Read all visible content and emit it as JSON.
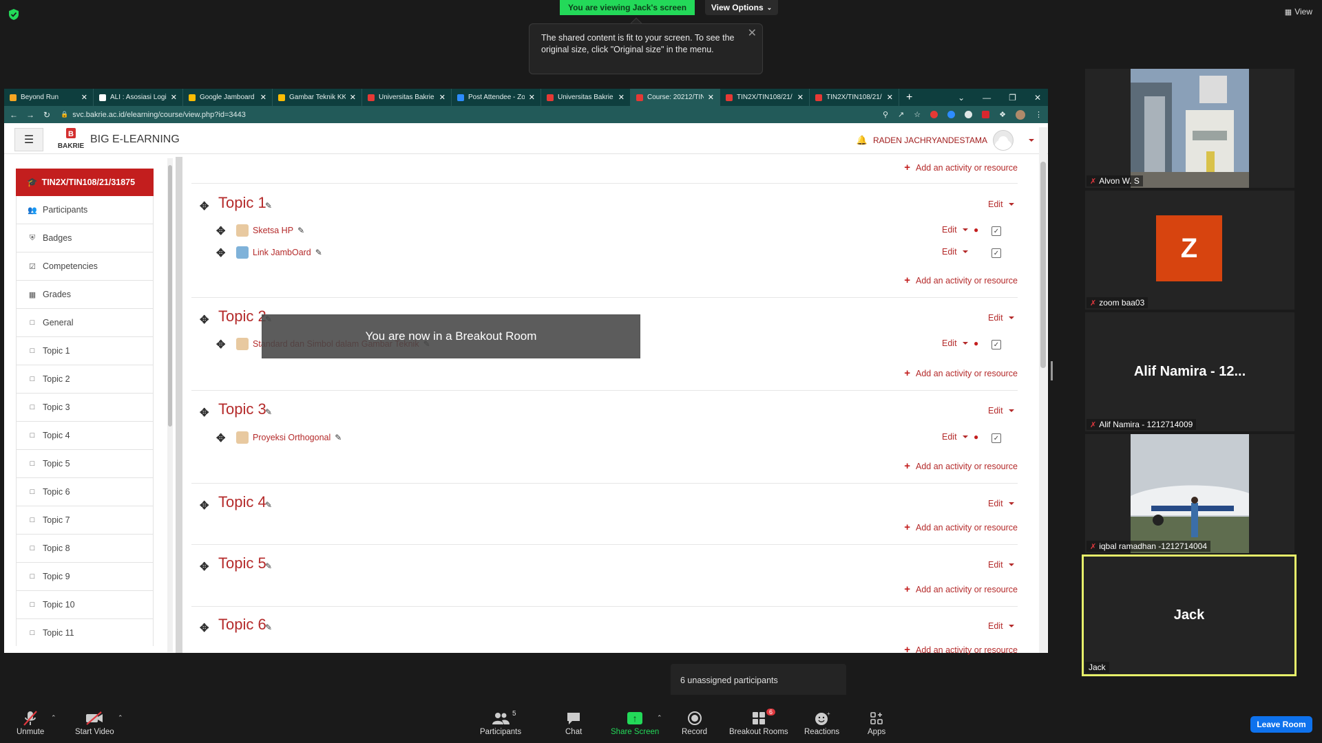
{
  "zoom": {
    "viewing_banner": "You are viewing Jack's screen",
    "view_options": "View Options",
    "view_top": "View",
    "tooltip_text": "The shared content is fit to your screen. To see the original size, click \"Original size\" in the menu.",
    "breakout_message": "You are now in a Breakout Room",
    "unassigned": "6 unassigned participants",
    "leave_room": "Leave Room",
    "toolbar": {
      "unmute": "Unmute",
      "start_video": "Start Video",
      "participants": "Participants",
      "participants_count": "5",
      "chat": "Chat",
      "share_screen": "Share Screen",
      "record": "Record",
      "breakout_rooms": "Breakout Rooms",
      "breakout_badge": "6",
      "reactions": "Reactions",
      "apps": "Apps"
    },
    "gallery": [
      {
        "name": "Alvon W. S"
      },
      {
        "name": "zoom baa03",
        "initial": "Z"
      },
      {
        "name": "Alif Namira - 1212714009",
        "center": "Alif Namira - 12..."
      },
      {
        "name": "iqbal ramadhan -1212714004"
      },
      {
        "name": "Jack",
        "center": "Jack"
      }
    ]
  },
  "browser": {
    "tabs": [
      {
        "title": "Beyond Run",
        "color": "#f5a623"
      },
      {
        "title": "ALI : Asosiasi Logis",
        "color": "#ffffff"
      },
      {
        "title": "Google Jamboard",
        "color": "#fbbc04"
      },
      {
        "title": "Gambar Teknik KK",
        "color": "#fbbc04"
      },
      {
        "title": "Universitas Bakrie",
        "color": "#e53935"
      },
      {
        "title": "Post Attendee - Zo",
        "color": "#2d8cff"
      },
      {
        "title": "Universitas Bakrie",
        "color": "#e53935"
      },
      {
        "title": "Course: 20212/TIN",
        "color": "#e53935"
      },
      {
        "title": "TIN2X/TIN108/21/",
        "color": "#e53935"
      },
      {
        "title": "TIN2X/TIN108/21/",
        "color": "#e53935"
      }
    ],
    "url": "svc.bakrie.ac.id/elearning/course/view.php?id=3443"
  },
  "moodle": {
    "site_name": "BIG E-LEARNING",
    "logo_text": "BAKRIE",
    "user_name": "RADEN JACHRYANDESTAMA",
    "course_short": "TIN2X/TIN108/21/31875",
    "nav": [
      {
        "label": "Participants",
        "icon": "users-icon"
      },
      {
        "label": "Badges",
        "icon": "badge-icon"
      },
      {
        "label": "Competencies",
        "icon": "check-square-icon"
      },
      {
        "label": "Grades",
        "icon": "table-icon"
      },
      {
        "label": "General",
        "icon": "folder-icon"
      },
      {
        "label": "Topic 1",
        "icon": "folder-icon"
      },
      {
        "label": "Topic 2",
        "icon": "folder-icon"
      },
      {
        "label": "Topic 3",
        "icon": "folder-icon"
      },
      {
        "label": "Topic 4",
        "icon": "folder-icon"
      },
      {
        "label": "Topic 5",
        "icon": "folder-icon"
      },
      {
        "label": "Topic 6",
        "icon": "folder-icon"
      },
      {
        "label": "Topic 7",
        "icon": "folder-icon"
      },
      {
        "label": "Topic 8",
        "icon": "folder-icon"
      },
      {
        "label": "Topic 9",
        "icon": "folder-icon"
      },
      {
        "label": "Topic 10",
        "icon": "folder-icon"
      },
      {
        "label": "Topic 11",
        "icon": "folder-icon"
      }
    ],
    "edit_label": "Edit",
    "add_activity": "Add an activity or resource",
    "topics": [
      {
        "title": "Topic 1",
        "activities": [
          "Sketsa HP",
          "Link JambOard"
        ]
      },
      {
        "title": "Topic 2",
        "activities": [
          "Standard dan Simbol dalam Gambar Teknik"
        ]
      },
      {
        "title": "Topic 3",
        "activities": [
          "Proyeksi Orthogonal"
        ]
      },
      {
        "title": "Topic 4",
        "activities": []
      },
      {
        "title": "Topic 5",
        "activities": []
      },
      {
        "title": "Topic 6",
        "activities": []
      }
    ]
  }
}
